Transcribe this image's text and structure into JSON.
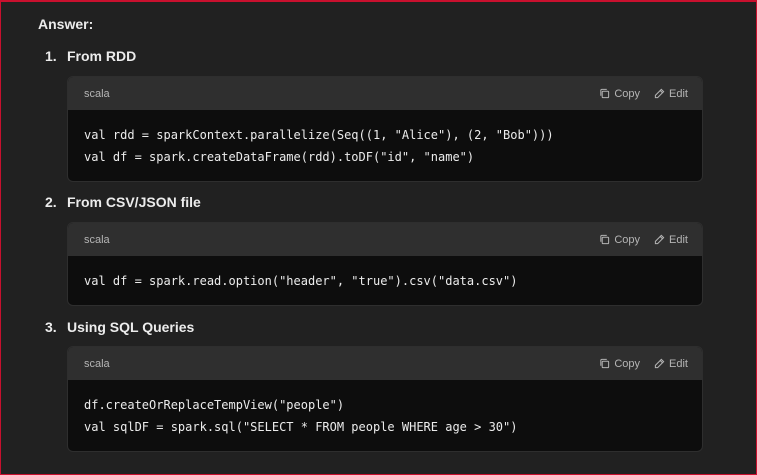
{
  "answer_label": "Answer:",
  "steps": [
    {
      "num": "1.",
      "title": "From RDD",
      "code": {
        "language": "scala",
        "copy_label": "Copy",
        "edit_label": "Edit",
        "lines": [
          "val rdd = sparkContext.parallelize(Seq((1, \"Alice\"), (2, \"Bob\")))",
          "val df = spark.createDataFrame(rdd).toDF(\"id\", \"name\")"
        ]
      }
    },
    {
      "num": "2.",
      "title": "From CSV/JSON file",
      "code": {
        "language": "scala",
        "copy_label": "Copy",
        "edit_label": "Edit",
        "lines": [
          "val df = spark.read.option(\"header\", \"true\").csv(\"data.csv\")"
        ]
      }
    },
    {
      "num": "3.",
      "title": "Using SQL Queries",
      "code": {
        "language": "scala",
        "copy_label": "Copy",
        "edit_label": "Edit",
        "lines": [
          "df.createOrReplaceTempView(\"people\")",
          "val sqlDF = spark.sql(\"SELECT * FROM people WHERE age > 30\")"
        ]
      }
    }
  ],
  "colors": {
    "background": "#212121",
    "code_header": "#2f2f2f",
    "code_body": "#0d0d0d",
    "border_accent": "#c8102e"
  }
}
